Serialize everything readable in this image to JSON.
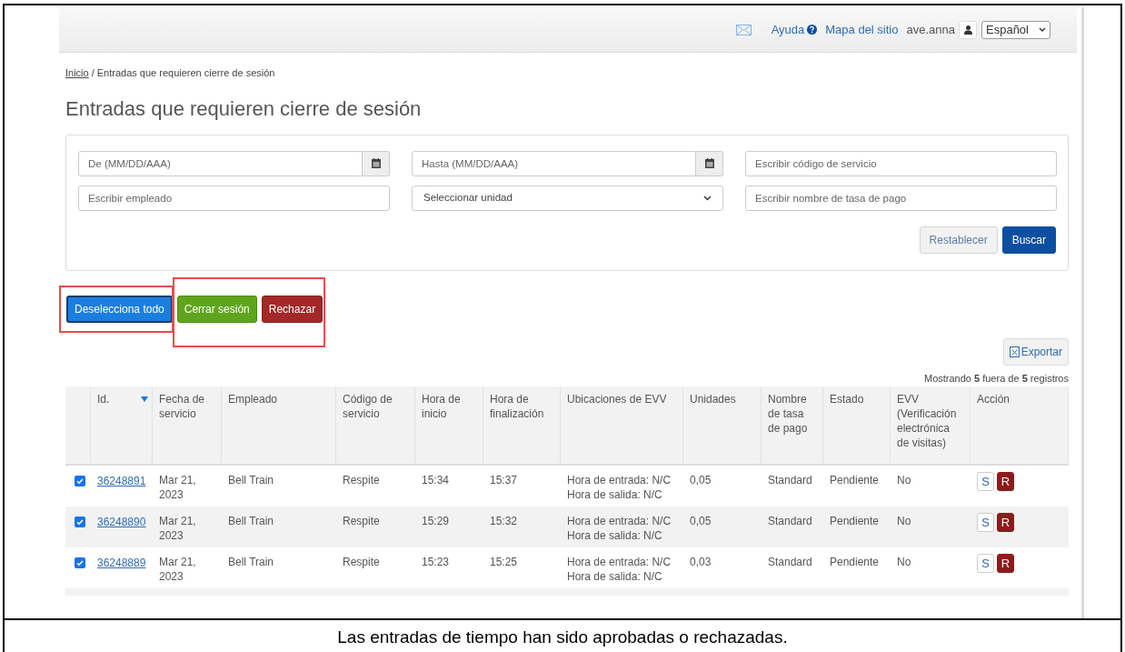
{
  "header": {
    "links": [
      {
        "label": "Ayuda",
        "kind": "help"
      },
      {
        "label": "Mapa del sitio",
        "kind": "plain"
      }
    ],
    "user": "ave.anna",
    "language": "Español"
  },
  "breadcrumb": {
    "home": "Inicio",
    "separator": "/",
    "current": "Entradas que requieren cierre de sesión"
  },
  "title": "Entradas que requieren cierre de sesión",
  "filters": {
    "fields": [
      {
        "kind": "date",
        "placeholder": "De (MM/DD/AAA)"
      },
      {
        "kind": "date",
        "placeholder": "Hasta (MM/DD/AAA)"
      },
      {
        "kind": "text",
        "placeholder": "Escribir código de servicio"
      },
      {
        "kind": "text",
        "placeholder": "Escribir empleado"
      },
      {
        "kind": "select",
        "value": "Seleccionar unidad"
      },
      {
        "kind": "text",
        "placeholder": "Escribir nombre de tasa de pago"
      }
    ],
    "buttons": [
      {
        "label": "Restablecer",
        "kind": "default"
      },
      {
        "label": "Buscar",
        "kind": "primary"
      }
    ]
  },
  "actions": [
    {
      "label": "Deselecciona todo",
      "kind": "primary"
    },
    {
      "label": "Cerrar sesión",
      "kind": "success"
    },
    {
      "label": "Rechazar",
      "kind": "danger"
    }
  ],
  "export": "Exportar",
  "record_count": "Mostrando **5** fuera de **5** registros",
  "table": {
    "columns": [
      {
        "label": "Id.",
        "sorted": true
      },
      {
        "label": "Fecha de servicio",
        "sorted": false
      },
      {
        "label": "Empleado",
        "sorted": false
      },
      {
        "label": "Código de servicio",
        "sorted": false
      },
      {
        "label": "Hora de inicio",
        "sorted": false
      },
      {
        "label": "Hora de finalización",
        "sorted": false
      },
      {
        "label": "Ubicaciones de EVV",
        "sorted": false
      },
      {
        "label": "Unidades",
        "sorted": false
      },
      {
        "label": "Nombre de tasa de pago",
        "sorted": false
      },
      {
        "label": "Estado",
        "sorted": false
      },
      {
        "label": "EVV (Verificación electrónica de visitas)",
        "sorted": false
      },
      {
        "label": "Acción",
        "sorted": false
      }
    ],
    "rows": [
      {
        "checked": true,
        "cells": [
          "36248891",
          "Mar 21, 2023",
          "Bell Train",
          "Respite",
          "15:34",
          "15:37",
          "Hora de entrada: N/C\nHora de salida: N/C",
          "0,05",
          "Standard",
          "Pendiente",
          "No"
        ],
        "actions": [
          {
            "label": "S",
            "kind": "outline"
          },
          {
            "label": "R",
            "kind": "danger"
          }
        ]
      },
      {
        "checked": true,
        "cells": [
          "36248890",
          "Mar 21, 2023",
          "Bell Train",
          "Respite",
          "15:29",
          "15:32",
          "Hora de entrada: N/C\nHora de salida: N/C",
          "0,05",
          "Standard",
          "Pendiente",
          "No"
        ],
        "actions": [
          {
            "label": "S",
            "kind": "outline"
          },
          {
            "label": "R",
            "kind": "danger"
          }
        ]
      },
      {
        "checked": true,
        "cells": [
          "36248889",
          "Mar 21, 2023",
          "Bell Train",
          "Respite",
          "15:23",
          "15:25",
          "Hora de entrada: N/C\nHora de salida: N/C",
          "0,03",
          "Standard",
          "Pendiente",
          "No"
        ],
        "actions": [
          {
            "label": "S",
            "kind": "outline"
          },
          {
            "label": "R",
            "kind": "danger"
          }
        ]
      }
    ]
  },
  "caption": "Las entradas de tiempo han sido aprobadas o rechazadas."
}
